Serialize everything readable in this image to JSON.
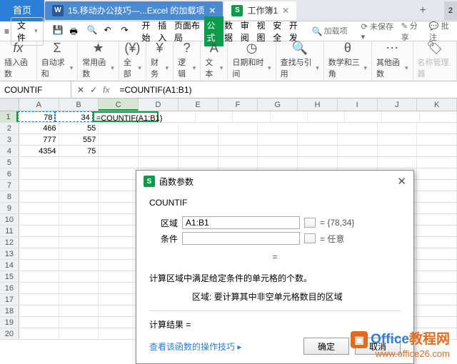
{
  "tabs": {
    "home": "首页",
    "doc1": "15.移动办公技巧—...Excel 的加载项",
    "doc2": "工作簿1",
    "plus": "+",
    "end": "2"
  },
  "menubar": {
    "file": "文件",
    "items": [
      "开始",
      "插入",
      "页面布局",
      "公式",
      "数据",
      "审阅",
      "视图",
      "安全",
      "开发"
    ],
    "active_index": 3,
    "search_placeholder": "加载项",
    "unsaved": "未保存",
    "share": "分享",
    "bulk": "批注"
  },
  "ribbon": {
    "insert_fn": "插入函数",
    "autosum": "自动求和",
    "common": "常用函数",
    "all": "全部",
    "finance": "财务",
    "logic": "逻辑",
    "text": "文本",
    "datetime": "日期和时间",
    "lookup": "查找与引用",
    "math": "数学和三角",
    "other": "其他函数",
    "name_mgr": "名称管理器"
  },
  "formula_bar": {
    "name_box": "COUNTIF",
    "formula": "=COUNTIF(A1:B1)"
  },
  "grid": {
    "cols": [
      "A",
      "B",
      "C",
      "D",
      "E",
      "F",
      "G",
      "H",
      "I",
      "J",
      "K"
    ],
    "rows": [
      {
        "n": "1",
        "cells": [
          "78",
          "34",
          "=COUNTIF(A1:B1)"
        ]
      },
      {
        "n": "2",
        "cells": [
          "466",
          "55",
          ""
        ]
      },
      {
        "n": "3",
        "cells": [
          "777",
          "557",
          ""
        ]
      },
      {
        "n": "4",
        "cells": [
          "4354",
          "75",
          ""
        ]
      },
      {
        "n": "5",
        "cells": [
          "",
          "",
          ""
        ]
      },
      {
        "n": "6",
        "cells": [
          "",
          "",
          ""
        ]
      },
      {
        "n": "7",
        "cells": [
          "",
          "",
          ""
        ]
      },
      {
        "n": "8",
        "cells": [
          "",
          "",
          ""
        ]
      },
      {
        "n": "9",
        "cells": [
          "",
          "",
          ""
        ]
      },
      {
        "n": "10",
        "cells": [
          "",
          "",
          ""
        ]
      },
      {
        "n": "11",
        "cells": [
          "",
          "",
          ""
        ]
      },
      {
        "n": "12",
        "cells": [
          "",
          "",
          ""
        ]
      },
      {
        "n": "13",
        "cells": [
          "",
          "",
          ""
        ]
      },
      {
        "n": "14",
        "cells": [
          "",
          "",
          ""
        ]
      },
      {
        "n": "15",
        "cells": [
          "",
          "",
          ""
        ]
      },
      {
        "n": "16",
        "cells": [
          "",
          "",
          ""
        ]
      },
      {
        "n": "17",
        "cells": [
          "",
          "",
          ""
        ]
      },
      {
        "n": "18",
        "cells": [
          "",
          "",
          ""
        ]
      },
      {
        "n": "19",
        "cells": [
          "",
          "",
          ""
        ]
      },
      {
        "n": "20",
        "cells": [
          "",
          "",
          ""
        ]
      }
    ]
  },
  "dialog": {
    "title": "函数参数",
    "func": "COUNTIF",
    "param1_label": "区域",
    "param1_value": "A1:B1",
    "param1_eval": "= {78,34}",
    "param2_label": "条件",
    "param2_value": "",
    "param2_eval": "= 任意",
    "mid_eq": "=",
    "desc1": "计算区域中满足给定条件的单元格的个数。",
    "desc2": "区域: 要计算其中非空单元格数目的区域",
    "result_label": "计算结果 =",
    "help_link": "查看该函数的操作技巧",
    "ok": "确定",
    "cancel": "取消"
  },
  "watermark": {
    "line1a": "Office",
    "line1b": "教程网",
    "line2": "www.office26.com"
  }
}
